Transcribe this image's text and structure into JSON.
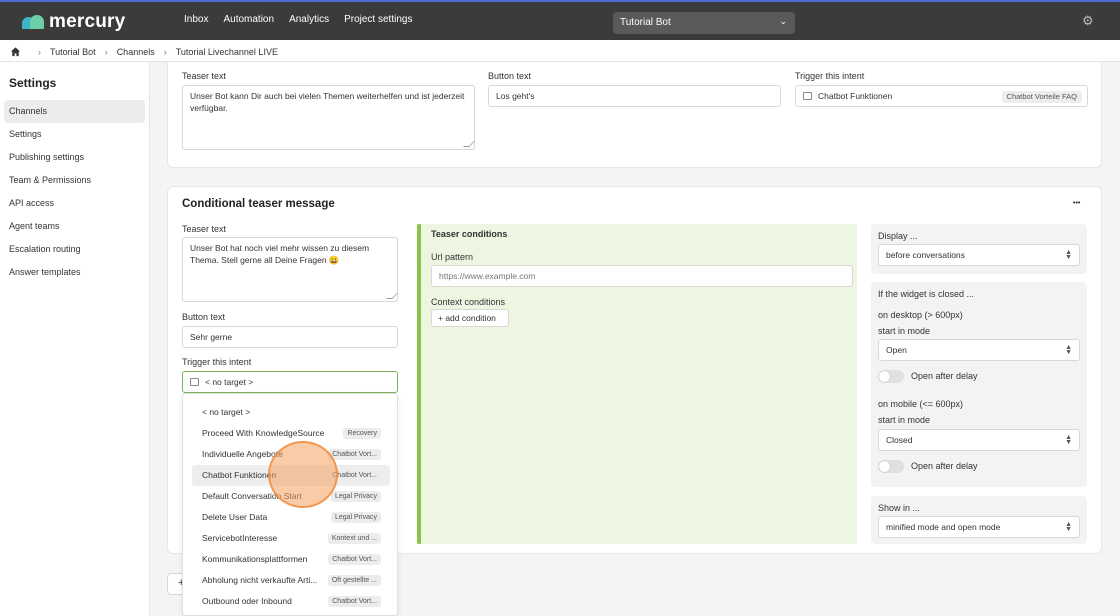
{
  "app": {
    "logo_text": "mercury",
    "project": "Tutorial Bot"
  },
  "nav": [
    "Inbox",
    "Automation",
    "Analytics",
    "Project settings"
  ],
  "breadcrumb": [
    "Tutorial Bot",
    "Channels",
    "Tutorial Livechannel LIVE"
  ],
  "sidebar": {
    "title": "Settings",
    "items": [
      "Channels",
      "Settings",
      "Publishing settings",
      "Team & Permissions",
      "API access",
      "Agent teams",
      "Escalation routing",
      "Answer templates"
    ],
    "active": "Channels"
  },
  "teaser": {
    "teaser_label": "Teaser text",
    "teaser_value": "Unser Bot kann Dir auch bei vielen Themen weiterhelfen und ist jederzeit verfügbar.",
    "button_label": "Button text",
    "button_value": "Los geht's",
    "trigger_label": "Trigger this intent",
    "trigger_value": "Chatbot Funktionen",
    "trigger_badge": "Chatbot Vorteile FAQ"
  },
  "conditional": {
    "title": "Conditional teaser message",
    "more": "•••",
    "teaser_label": "Teaser text",
    "teaser_value": "Unser Bot hat noch viel mehr wissen zu diesem Thema. Stell gerne all Deine Fragen 😀",
    "button_label": "Button text",
    "button_value": "Sehr gerne",
    "trigger_label": "Trigger this intent",
    "trigger_value": "< no target >",
    "conditions_title": "Teaser conditions",
    "url_label": "Url pattern",
    "url_placeholder": "https://www.example.com",
    "context_label": "Context conditions",
    "add_condition": "+ add condition"
  },
  "right_panel": {
    "display_label": "Display ...",
    "display_value": "before conversations",
    "closed_title": "If the widget is closed ...",
    "desktop_label": "on desktop (> 600px)",
    "desktop_mode_label": "start in mode",
    "desktop_mode_value": "Open",
    "desktop_delay": "Open after delay",
    "mobile_label": "on mobile (<= 600px)",
    "mobile_mode_label": "start in mode",
    "mobile_mode_value": "Closed",
    "mobile_delay": "Open after delay",
    "show_label": "Show in ...",
    "show_value": "minified mode and open mode"
  },
  "dropdown": [
    {
      "label": "< no target >",
      "badge": ""
    },
    {
      "label": "Proceed With KnowledgeSource",
      "badge": "Recovery"
    },
    {
      "label": "Individuelle Angebote",
      "badge": "Chatbot Vort..."
    },
    {
      "label": "Chatbot Funktionen",
      "badge": "Chatbot Vort..."
    },
    {
      "label": "Default Conversation Start",
      "badge": "Legal Privacy"
    },
    {
      "label": "Delete User Data",
      "badge": "Legal Privacy"
    },
    {
      "label": "ServicebotInteresse",
      "badge": "Kontext und ..."
    },
    {
      "label": "Kommunikationsplattformen",
      "badge": "Chatbot Vort..."
    },
    {
      "label": "Abholung nicht verkaufte Arti...",
      "badge": "Oft gestellte ..."
    },
    {
      "label": "Outbound oder Inbound",
      "badge": "Chatbot Vort..."
    }
  ],
  "add_button": "+"
}
